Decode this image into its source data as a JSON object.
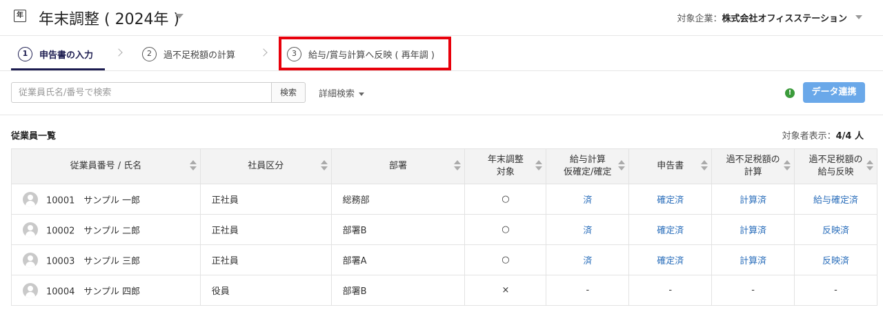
{
  "header": {
    "app_icon": "年",
    "title": "年末調整 ( 2024年 )",
    "company_label": "対象企業：",
    "company_name": "株式会社オフィスステーション"
  },
  "steps": [
    {
      "num": "1",
      "label": "申告書の入力",
      "active": true
    },
    {
      "num": "2",
      "label": "過不足税額の計算",
      "active": false
    },
    {
      "num": "3",
      "label": "給与/賞与計算へ反映 ( 再年調 )",
      "active": false
    }
  ],
  "search": {
    "placeholder": "従業員氏名/番号で検索",
    "button": "検索",
    "advanced": "詳細検索",
    "status_icon": "!",
    "sync_button": "データ連携"
  },
  "list": {
    "title": "従業員一覧",
    "count_label": "対象者表示：",
    "count_value": "4/4 人"
  },
  "table": {
    "columns": [
      [
        "従業員番号 / 氏名"
      ],
      [
        "社員区分"
      ],
      [
        "部署"
      ],
      [
        "年末調整",
        "対象"
      ],
      [
        "給与計算",
        "仮確定/確定"
      ],
      [
        "申告書"
      ],
      [
        "過不足税額の",
        "計算"
      ],
      [
        "過不足税額の",
        "給与反映"
      ]
    ],
    "rows": [
      {
        "id_name": "10001　サンプル 一郎",
        "type": "正社員",
        "dept": "総務部",
        "target": "○",
        "payroll": "済",
        "form": "確定済",
        "calc": "計算済",
        "reflect": "給与確定済"
      },
      {
        "id_name": "10002　サンプル 二郎",
        "type": "正社員",
        "dept": "部署B",
        "target": "○",
        "payroll": "済",
        "form": "確定済",
        "calc": "計算済",
        "reflect": "反映済"
      },
      {
        "id_name": "10003　サンプル 三郎",
        "type": "正社員",
        "dept": "部署A",
        "target": "○",
        "payroll": "済",
        "form": "確定済",
        "calc": "計算済",
        "reflect": "反映済"
      },
      {
        "id_name": "10004　サンプル 四郎",
        "type": "役員",
        "dept": "部署B",
        "target": "×",
        "payroll": "-",
        "form": "-",
        "calc": "-",
        "reflect": "-"
      }
    ]
  },
  "colors": {
    "accent": "#1b1b4f",
    "link": "#2a6ebb",
    "highlight": "#e8000b",
    "sync_button": "#6aa8e9",
    "status_ok": "#3b9b3b"
  }
}
